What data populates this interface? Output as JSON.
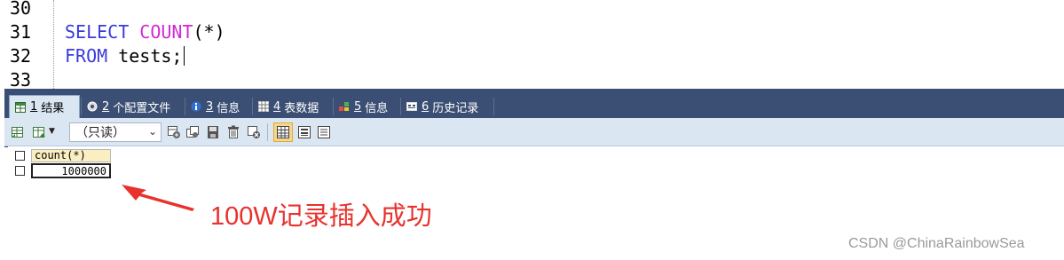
{
  "editor": {
    "line_numbers": [
      "30",
      "31",
      "32",
      "33"
    ],
    "line31": {
      "kw1": "SELECT",
      "fn": "COUNT",
      "args": "(*)"
    },
    "line32": {
      "kw": "FROM",
      "rest": "tests;"
    }
  },
  "tabs": [
    {
      "num": "1",
      "label": "结果",
      "icon": "result-table-icon"
    },
    {
      "num": "2",
      "label": "个配置文件",
      "icon": "profile-icon"
    },
    {
      "num": "3",
      "label": "信息",
      "icon": "info-icon"
    },
    {
      "num": "4",
      "label": "表数据",
      "icon": "table-data-icon"
    },
    {
      "num": "5",
      "label": "信息",
      "icon": "info-tree-icon"
    },
    {
      "num": "6",
      "label": "历史记录",
      "icon": "history-icon"
    }
  ],
  "toolbar": {
    "mode_select": "（只读）"
  },
  "grid": {
    "columns": [
      "count(*)"
    ],
    "rows": [
      [
        "1000000"
      ]
    ]
  },
  "annotation": "100W记录插入成功",
  "watermark": "CSDN @ChinaRainbowSea",
  "colors": {
    "tab_bg": "#3b4f74",
    "toolbar_bg": "#dbe6f3",
    "header_cell": "#fbeec0",
    "annotation": "#e8322d"
  }
}
